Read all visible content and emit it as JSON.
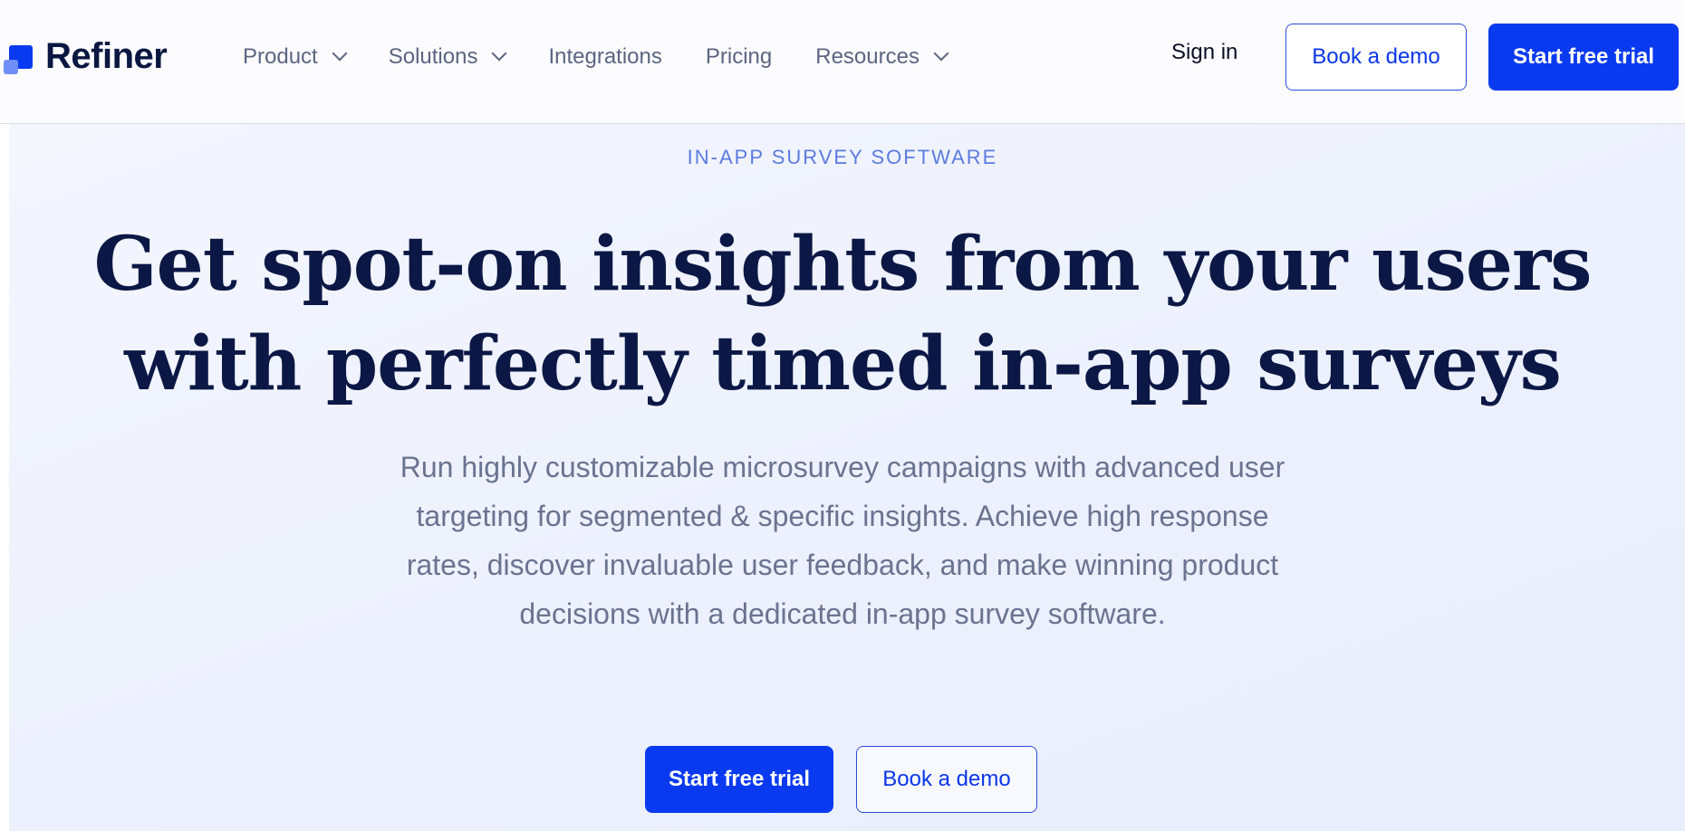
{
  "header": {
    "logo_text": "Refiner",
    "nav": {
      "product": "Product",
      "solutions": "Solutions",
      "integrations": "Integrations",
      "pricing": "Pricing",
      "resources": "Resources"
    },
    "sign_in": "Sign in",
    "book_demo": "Book a demo",
    "start_trial": "Start free trial"
  },
  "hero": {
    "eyebrow": "IN-APP SURVEY SOFTWARE",
    "headline_line1": "Get spot-on insights from your users",
    "headline_line2": "with perfectly timed in-app surveys",
    "subtext": "Run highly customizable microsurvey campaigns with advanced user targeting for segmented & specific insights. Achieve high response rates, discover invaluable user feedback, and make winning product decisions with a dedicated in-app survey software.",
    "start_trial": "Start free trial",
    "book_demo": "Book a demo"
  },
  "colors": {
    "brand_blue": "#0a3af0",
    "brand_light_blue": "#6f8ef7",
    "navy_text": "#0b1845",
    "muted_text": "#6a7390",
    "eyebrow_blue": "#5b7be0"
  }
}
